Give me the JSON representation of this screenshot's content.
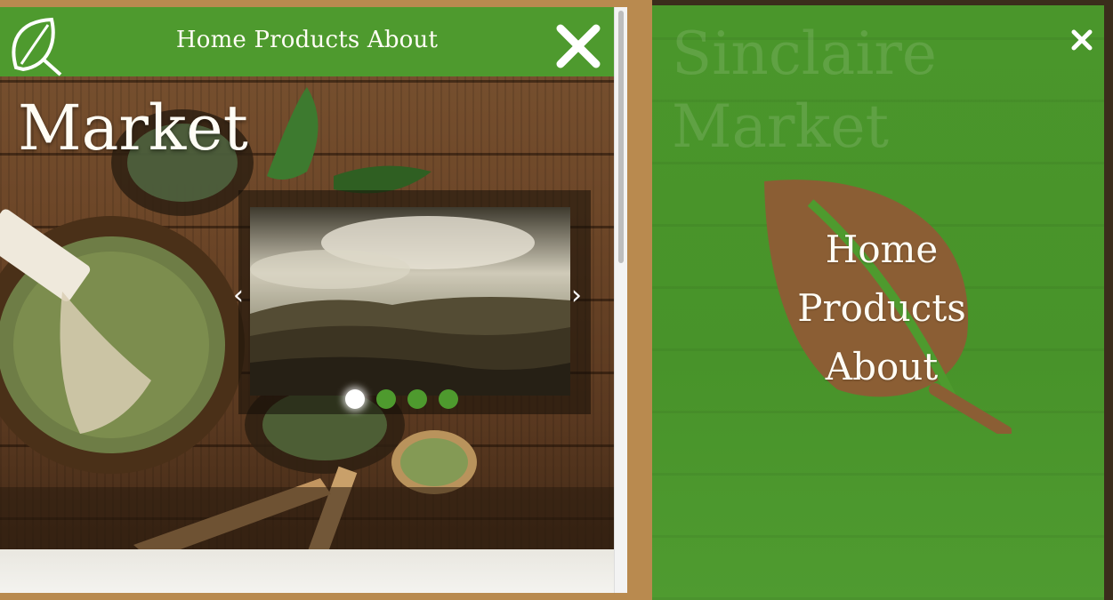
{
  "site": {
    "brand_partial": "Market",
    "watermark": "Sinclaire",
    "watermark_line2": "Market"
  },
  "header": {
    "nav_inline": "Home Products About"
  },
  "carousel": {
    "prev_glyph": "‹",
    "next_glyph": "›",
    "slides_count": 4,
    "active_index": 0
  },
  "overlay_menu": {
    "items": [
      "Home",
      "Products",
      "About"
    ]
  },
  "icons": {
    "logo": "leaf-icon",
    "close": "close-icon",
    "prev": "chevron-left-icon",
    "next": "chevron-right-icon"
  },
  "colors": {
    "brand_green": "#4e9a2e",
    "leaf_brown": "#8b5e34",
    "frame_tan": "#b98a4f",
    "text_cream": "#fffdf5"
  }
}
